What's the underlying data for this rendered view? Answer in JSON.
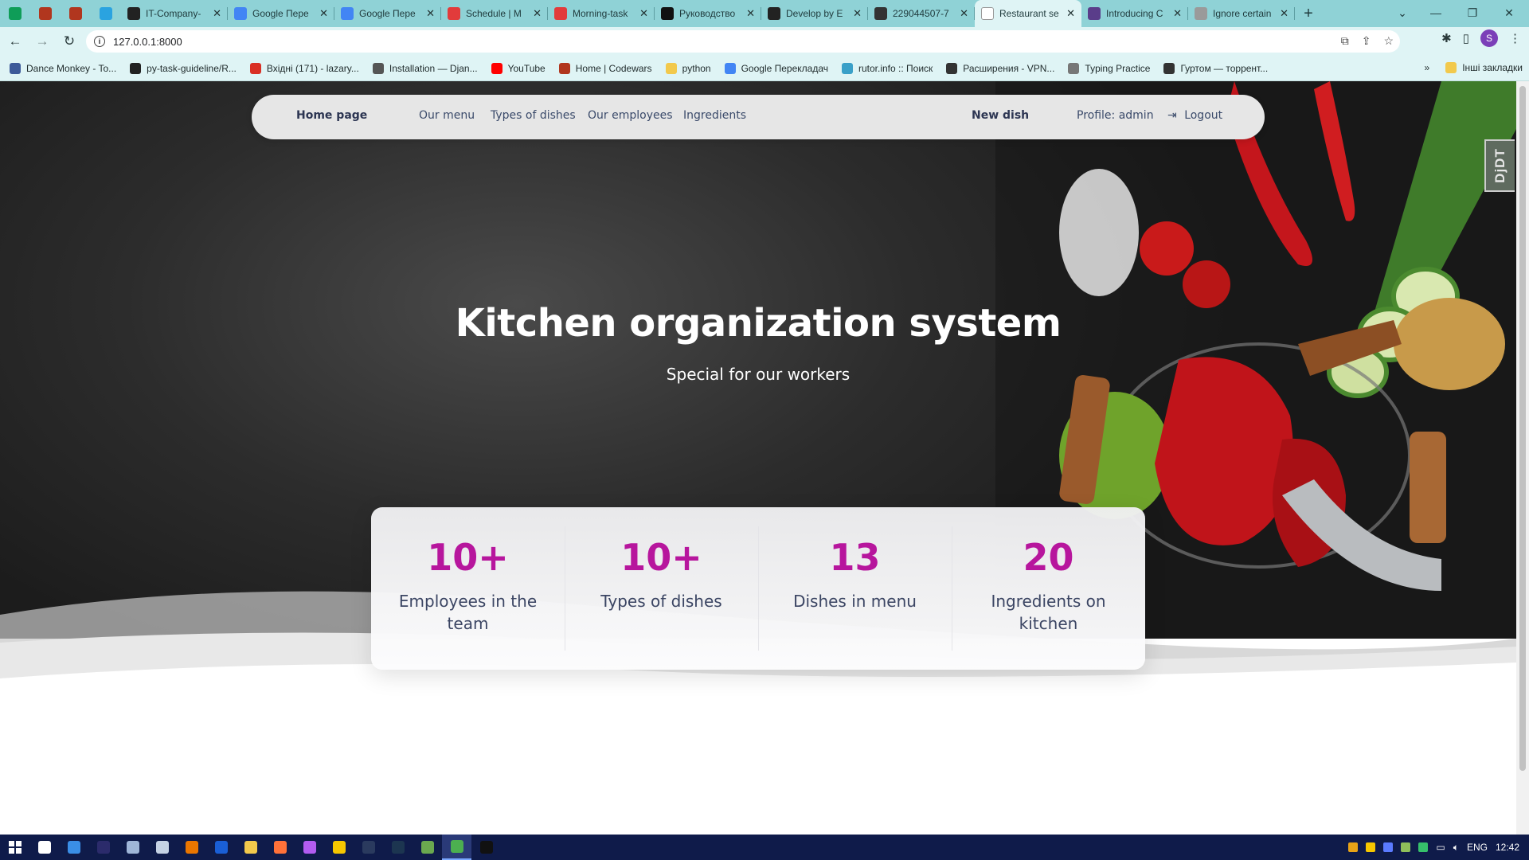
{
  "browser": {
    "tabs": [
      {
        "title": "",
        "icon": "sheets-icon",
        "color": "#0f9d58",
        "icon_only": true
      },
      {
        "title": "",
        "icon": "codewars-icon",
        "color": "#b1361e",
        "icon_only": true
      },
      {
        "title": "",
        "icon": "codewars-icon",
        "color": "#b1361e",
        "icon_only": true
      },
      {
        "title": "",
        "icon": "telegram-icon",
        "color": "#2aa3e0",
        "icon_only": true
      },
      {
        "title": "IT-Company-",
        "icon": "github-icon",
        "color": "#222222"
      },
      {
        "title": "Google Пере",
        "icon": "google-translate-icon",
        "color": "#4285f4"
      },
      {
        "title": "Google Пере",
        "icon": "google-translate-icon",
        "color": "#4285f4"
      },
      {
        "title": "Schedule | M",
        "icon": "mate-icon",
        "color": "#e23b3b"
      },
      {
        "title": "Morning-task",
        "icon": "mate-icon",
        "color": "#e23b3b"
      },
      {
        "title": "Руководство",
        "icon": "medium-icon",
        "color": "#111111"
      },
      {
        "title": "Develop by E",
        "icon": "github-icon",
        "color": "#222222"
      },
      {
        "title": "229044507-7",
        "icon": "globe-icon",
        "color": "#333333"
      },
      {
        "title": "Restaurant se",
        "icon": "page-icon",
        "color": "#ffffff",
        "active": true
      },
      {
        "title": "Introducing C",
        "icon": "site-icon",
        "color": "#5a3d8a"
      },
      {
        "title": "Ignore certain",
        "icon": "globe-icon",
        "color": "#9a9a9a"
      }
    ],
    "url": "127.0.0.1:8000",
    "bookmarks": [
      {
        "label": "Dance Monkey - To...",
        "icon": "bookmark-site-icon",
        "color": "#3d5a99"
      },
      {
        "label": "py-task-guideline/R...",
        "icon": "github-icon",
        "color": "#222222"
      },
      {
        "label": "Вхідні (171) - lazary...",
        "icon": "gmail-icon",
        "color": "#d93025"
      },
      {
        "label": "Installation — Djan...",
        "icon": "docs-icon",
        "color": "#555555"
      },
      {
        "label": "YouTube",
        "icon": "youtube-icon",
        "color": "#ff0000"
      },
      {
        "label": "Home | Codewars",
        "icon": "codewars-icon",
        "color": "#b1361e"
      },
      {
        "label": "python",
        "icon": "folder-icon",
        "color": "#f2c94c"
      },
      {
        "label": "Google Перекладач",
        "icon": "google-translate-icon",
        "color": "#4285f4"
      },
      {
        "label": "rutor.info :: Поиск",
        "icon": "shield-icon",
        "color": "#3aa0c8"
      },
      {
        "label": "Расширения - VPN...",
        "icon": "puzzle-icon",
        "color": "#333333"
      },
      {
        "label": "Typing Practice",
        "icon": "keyboard-icon",
        "color": "#777777"
      },
      {
        "label": "Гуртом — торрент...",
        "icon": "site-icon",
        "color": "#333333"
      }
    ],
    "other_bookmarks": "Інші закладки",
    "profile_letter": "S"
  },
  "site": {
    "nav": {
      "home": "Home page",
      "menu": "Our menu",
      "types": "Types of dishes",
      "employees": "Our employees",
      "ingredients": "Ingredients",
      "new_dish": "New dish",
      "profile": "Profile: admin",
      "logout": "Logout"
    },
    "hero": {
      "title": "Kitchen organization system",
      "subtitle": "Special for our workers"
    },
    "stats": [
      {
        "value": "10+",
        "label": "Employees in the team"
      },
      {
        "value": "10+",
        "label": "Types of dishes"
      },
      {
        "value": "13",
        "label": "Dishes in menu"
      },
      {
        "value": "20",
        "label": "Ingredients on kitchen"
      }
    ],
    "accent_color": "#b7169d",
    "djdt_label": "DjDT"
  },
  "taskbar": {
    "language": "ENG",
    "time": "12:42",
    "apps": [
      {
        "name": "task-view-icon",
        "color": "#ffffff"
      },
      {
        "name": "mail-icon",
        "color": "#3a8ee6"
      },
      {
        "name": "after-effects-icon",
        "color": "#2b2b6b"
      },
      {
        "name": "store-icon",
        "color": "#9fb6d8"
      },
      {
        "name": "steam-icon",
        "color": "#c5d2e4"
      },
      {
        "name": "blender-icon",
        "color": "#ea7600"
      },
      {
        "name": "1password-icon",
        "color": "#1a5fd6"
      },
      {
        "name": "explorer-icon",
        "color": "#f2c94c"
      },
      {
        "name": "firefox-icon",
        "color": "#ff7139"
      },
      {
        "name": "discord-icon",
        "color": "#b25cf0"
      },
      {
        "name": "app-yellow-icon",
        "color": "#f6c700"
      },
      {
        "name": "lightroom-icon",
        "color": "#2a3a5e"
      },
      {
        "name": "photoshop-icon",
        "color": "#1c3550"
      },
      {
        "name": "xbox-icon",
        "color": "#6aa84f"
      },
      {
        "name": "chrome-icon",
        "color": "#4caf50",
        "active": true
      },
      {
        "name": "pycharm-icon",
        "color": "#111111"
      }
    ]
  }
}
